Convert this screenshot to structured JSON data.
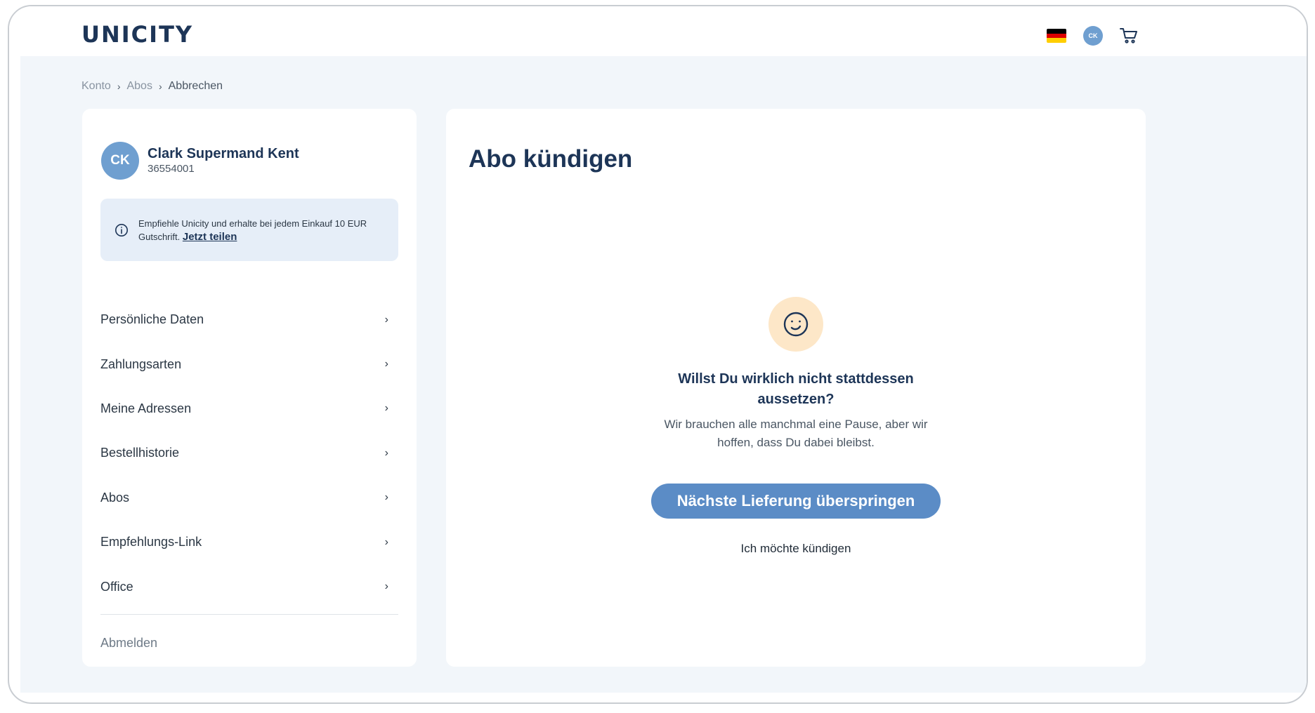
{
  "header": {
    "logo_text": "UNICITY",
    "avatar_initials": "CK",
    "flag": "germany-flag",
    "flag_colors": [
      "#000000",
      "#dd0000",
      "#ffce00"
    ],
    "cart_icon": "shopping-cart-icon"
  },
  "breadcrumb": {
    "items": [
      "Konto",
      "Abos",
      "Abbrechen"
    ],
    "separator": "›"
  },
  "sidebar": {
    "avatar_initials": "CK",
    "user_name": "Clark Supermand Kent",
    "user_id": "36554001",
    "info": {
      "text": "Empfiehle Unicity und erhalte bei jedem Einkauf 10 EUR Gutschrift.",
      "link": "Jetzt teilen"
    },
    "items": [
      {
        "label": "Persönliche Daten"
      },
      {
        "label": "Zahlungsarten"
      },
      {
        "label": "Meine Adressen"
      },
      {
        "label": "Bestellhistorie"
      },
      {
        "label": "Abos"
      },
      {
        "label": "Empfehlungs-Link"
      },
      {
        "label": "Office"
      }
    ],
    "chevron": "›",
    "logout": "Abmelden"
  },
  "main": {
    "title": "Abo kündigen",
    "question": "Willst Du wirklich nicht stattdessen aussetzen?",
    "subtext": "Wir brauchen alle manchmal eine Pause, aber wir hoffen, dass Du dabei bleibst.",
    "skip_button": "Nächste Lieferung überspringen",
    "cancel_link": "Ich möchte kündigen"
  },
  "colors": {
    "brand_navy": "#1d3557",
    "accent_blue": "#5b8cc6",
    "avatar_blue": "#6f9fd0",
    "page_bg": "#f2f6fa",
    "emoji_bg": "#fde7c8"
  }
}
